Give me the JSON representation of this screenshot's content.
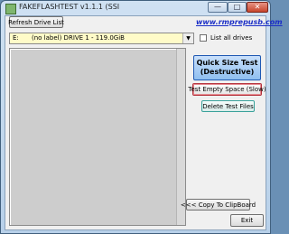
{
  "window": {
    "title": "FAKEFLASHTEST v1.1.1 (SSI",
    "controls": {
      "minimize": "—",
      "maximize": "□",
      "close": "✕"
    }
  },
  "toolbar": {
    "refresh_label": "Refresh Drive List",
    "link_text": "www.rmprepusb.com"
  },
  "drive": {
    "letter": "E:",
    "description": "(no label)   DRIVE 1 -  119.0GiB",
    "list_all_label": "List all drives",
    "list_all_checked": false
  },
  "actions": {
    "quick_size_line1": "Quick Size Test",
    "quick_size_line2": "(Destructive)",
    "test_empty_label": "Test Empty Space (Slow)",
    "delete_files_label": "Delete Test Files",
    "copy_clipboard_label": "<<< Copy To ClipBoard",
    "exit_label": "Exit"
  },
  "colors": {
    "drive_select_bg": "#fffbc8",
    "quick_button": "#8fbff0",
    "link": "#1b2ec7",
    "test_empty_border": "#b6333e",
    "delete_border": "#39a19a"
  }
}
